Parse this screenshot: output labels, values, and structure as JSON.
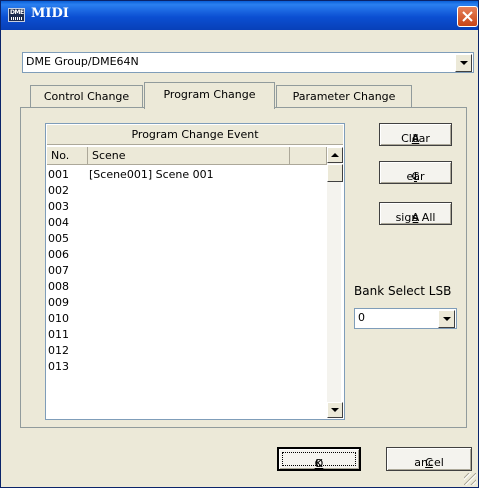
{
  "window": {
    "title": "MIDI",
    "icon_text": "DME"
  },
  "device_selector": {
    "value": "DME Group/DME64N"
  },
  "tabs": [
    {
      "label": "Control Change",
      "active": false
    },
    {
      "label": "Program Change",
      "active": true
    },
    {
      "label": "Parameter Change",
      "active": false
    }
  ],
  "event_list": {
    "title": "Program Change Event",
    "columns": [
      "No.",
      "Scene"
    ],
    "rows": [
      {
        "no": "001",
        "scene": "[Scene001] Scene 001"
      },
      {
        "no": "002",
        "scene": ""
      },
      {
        "no": "003",
        "scene": ""
      },
      {
        "no": "004",
        "scene": ""
      },
      {
        "no": "005",
        "scene": ""
      },
      {
        "no": "006",
        "scene": ""
      },
      {
        "no": "007",
        "scene": ""
      },
      {
        "no": "008",
        "scene": ""
      },
      {
        "no": "009",
        "scene": ""
      },
      {
        "no": "010",
        "scene": ""
      },
      {
        "no": "011",
        "scene": ""
      },
      {
        "no": "012",
        "scene": ""
      },
      {
        "no": "013",
        "scene": ""
      }
    ]
  },
  "buttons": {
    "clear_all": {
      "pre": "Clear ",
      "accel": "A",
      "post": "ll"
    },
    "clear": {
      "pre": "C",
      "accel": "l",
      "post": "ear"
    },
    "assign_all": {
      "pre": "A",
      "accel": "s",
      "post": "sign All"
    },
    "ok": {
      "pre": "",
      "accel": "O",
      "post": "K"
    },
    "cancel": {
      "pre": "",
      "accel": "C",
      "post": "ancel"
    }
  },
  "bank_select": {
    "label": "Bank Select LSB",
    "value": "0"
  },
  "colors": {
    "titlebar": "#0a5fd8",
    "dialog_bg": "#ece9d8",
    "close_button": "#d45a2a"
  }
}
